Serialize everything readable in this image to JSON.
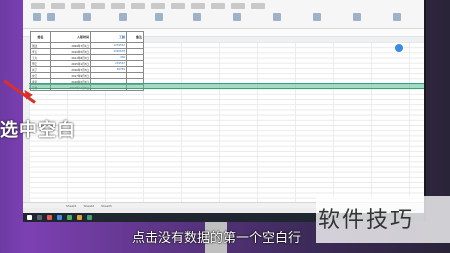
{
  "table": {
    "headers": [
      "姓名",
      "入职时间",
      "工龄",
      "备注"
    ],
    "rows": [
      [
        "张四",
        "2009年7月1日",
        "1234567",
        ""
      ],
      [
        "李五",
        "2010年5月3日",
        "2345678",
        ""
      ],
      [
        "王六",
        "2011年8月3日",
        "456",
        ""
      ],
      [
        "甲乙",
        "2015年1月3日",
        "234567",
        ""
      ],
      [
        "丙丁",
        "2016年7月3日",
        "56789",
        ""
      ],
      [
        "戊己",
        "2017年9月3日",
        "",
        ""
      ],
      [
        "庚辛",
        "2018年5月3日",
        "",
        ""
      ],
      [
        "壬癸",
        "2019年12月3日",
        "",
        ""
      ]
    ]
  },
  "sheet_tabs": [
    "Sheet1",
    "Sheet2",
    "Sheet3"
  ],
  "caption_left": "选中空白",
  "subtitle": "点击没有数据的第一个空白行",
  "brand": "软件技巧",
  "colors": {
    "highlight": "#5abe96",
    "arrow": "#d9302c",
    "accent": "#3d8be0"
  }
}
